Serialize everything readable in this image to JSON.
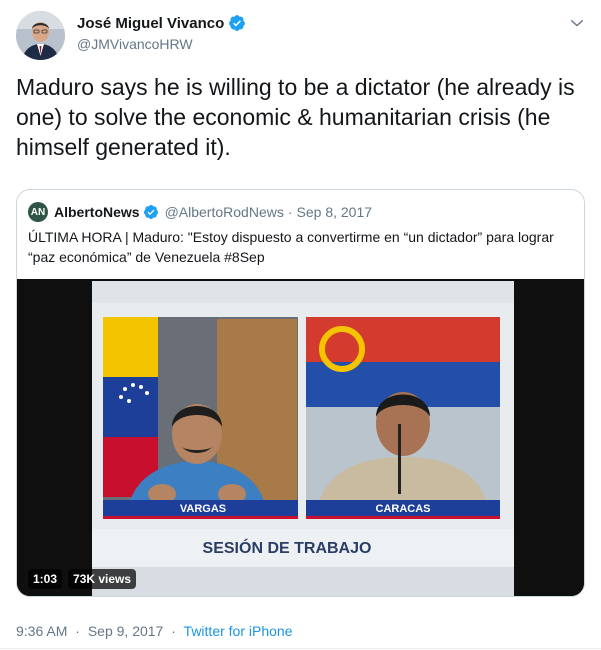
{
  "tweet": {
    "author_name": "José Miguel Vivanco",
    "author_handle": "@JMVivancoHRW",
    "text": "Maduro says he is willing to be a dictator (he already is one) to solve the economic & humanitarian crisis (he himself generated it).",
    "time": "9:36 AM",
    "date": "Sep 9, 2017",
    "source": "Twitter for iPhone",
    "separator": "·"
  },
  "quoted": {
    "avatar_text": "AN",
    "author_name": "AlbertoNews",
    "author_handle": "@AlbertoRodNews",
    "separator": "·",
    "date": "Sep 8, 2017",
    "text": "ÚLTIMA HORA | Maduro: \"Estoy dispuesto a convertirme en “un dictador” para lograr “paz económica” de Venezuela #8Sep",
    "video": {
      "duration": "1:03",
      "views": "73K views",
      "label_left": "VARGAS",
      "label_right": "CARACAS",
      "caption": "SESIÓN DE TRABAJO"
    }
  },
  "icons": {
    "verified": "verified-badge-icon",
    "caret": "chevron-down-icon"
  },
  "colors": {
    "text": "#14171a",
    "secondary": "#657786",
    "link": "#1b95e0",
    "verified": "#1da1f2",
    "border": "#ccd6dd"
  }
}
